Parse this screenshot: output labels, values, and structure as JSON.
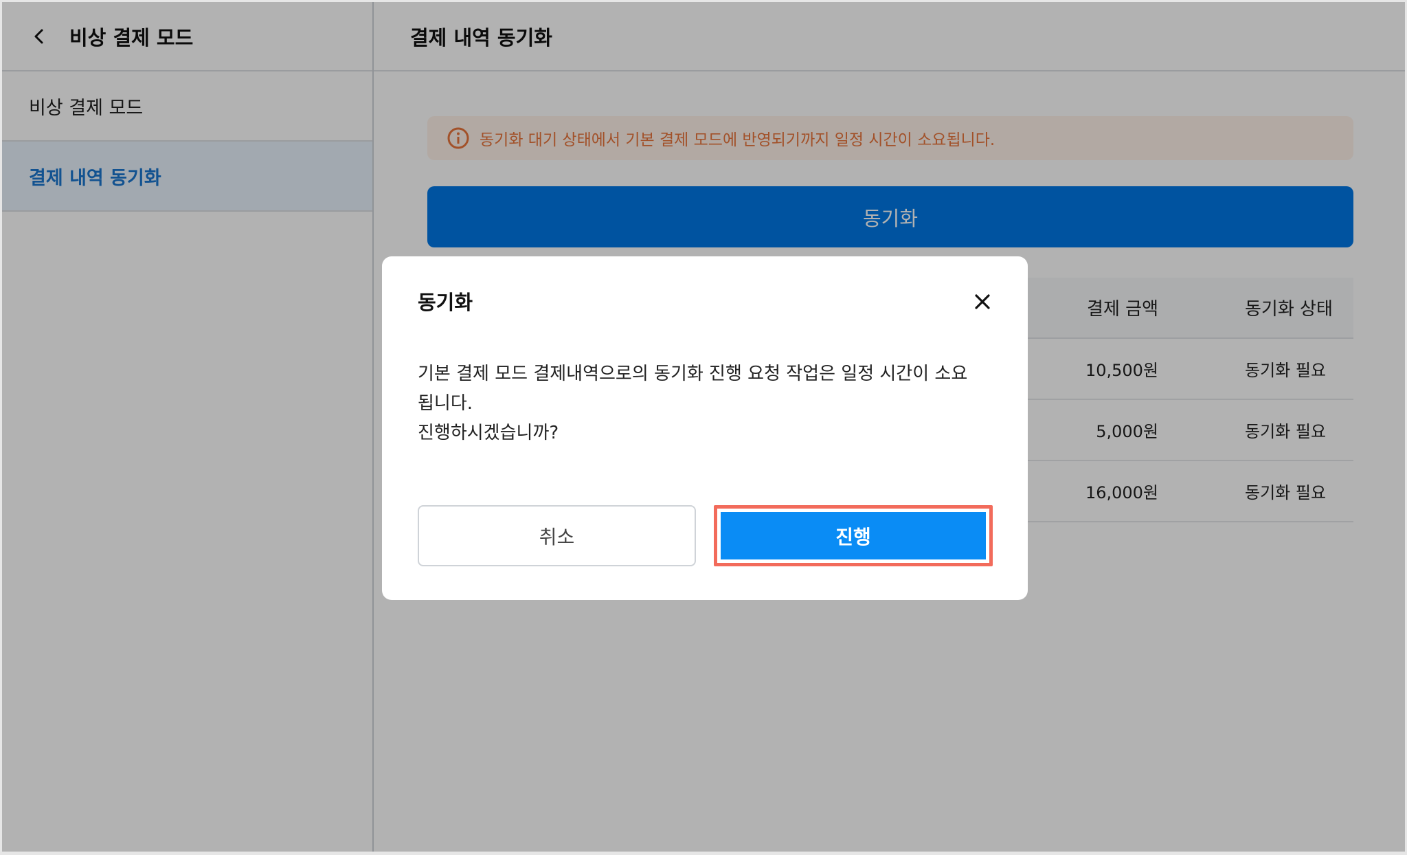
{
  "sidebar": {
    "title": "비상 결제 모드",
    "items": [
      {
        "label": "비상 결제 모드",
        "active": false
      },
      {
        "label": "결제 내역 동기화",
        "active": true
      }
    ]
  },
  "main": {
    "title": "결제 내역 동기화",
    "notice": "동기화 대기 상태에서 기본 결제 모드에 반영되기까지 일정 시간이 소요됩니다.",
    "sync_button": "동기화",
    "table": {
      "headers": {
        "amount": "결제 금액",
        "status": "동기화 상태"
      },
      "rows": [
        {
          "amount": "10,500원",
          "status": "동기화 필요"
        },
        {
          "amount": "5,000원",
          "status": "동기화 필요"
        },
        {
          "amount": "16,000원",
          "status": "동기화 필요"
        }
      ]
    }
  },
  "modal": {
    "title": "동기화",
    "message_line1": "기본 결제 모드 결제내역으로의 동기화 진행 요청 작업은 일정 시간이 소요됩니다.",
    "message_line2": "진행하시겠습니까?",
    "cancel_label": "취소",
    "proceed_label": "진행"
  },
  "colors": {
    "primary": "#0a8cf5",
    "notice_text": "#e8743c",
    "highlight": "#f26b5b"
  }
}
